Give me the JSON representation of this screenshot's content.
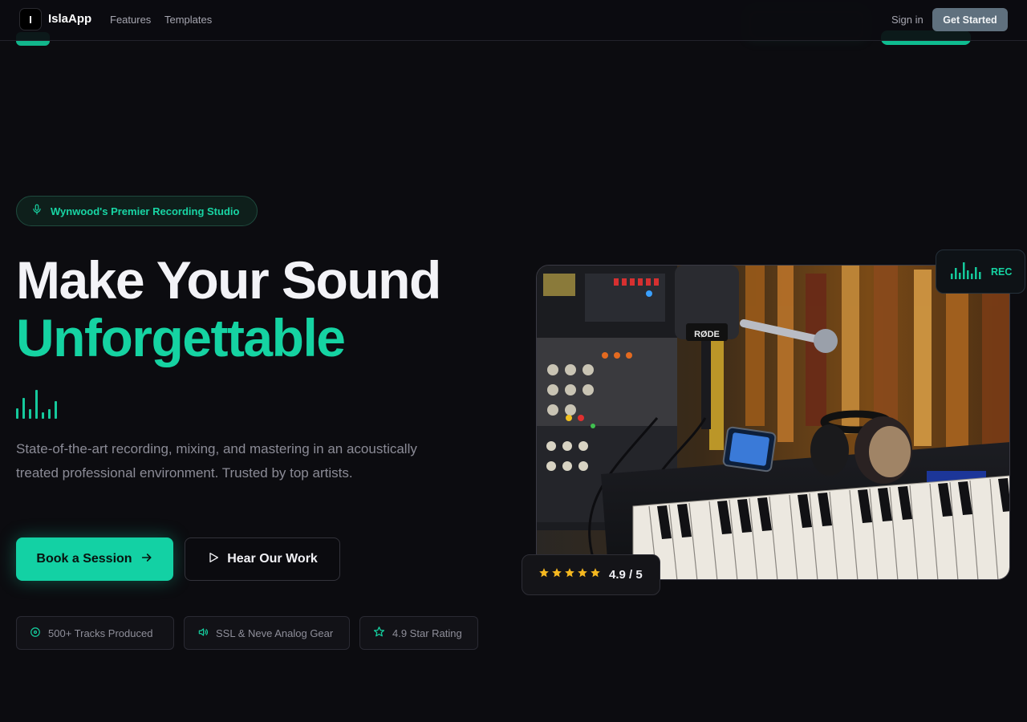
{
  "nav": {
    "logo_letter": "I",
    "brand": "IslaApp",
    "links": [
      "Features",
      "Templates"
    ],
    "signin": "Sign in",
    "cta": "Get Started"
  },
  "hero": {
    "badge": "Wynwood's Premier Recording Studio",
    "title_line1": "Make Your Sound",
    "title_line2": "Unforgettable",
    "description": "State-of-the-art recording, mixing, and mastering in an acoustically treated professional environment. Trusted by top artists.",
    "primary_button": "Book a Session",
    "secondary_button": "Hear Our Work",
    "stats": [
      "500+ Tracks Produced",
      "SSL & Neve Analog Gear",
      "4.9 Star Rating"
    ]
  },
  "media": {
    "rec_label": "REC",
    "mic_brand": "RØDE",
    "rating_stars": 5,
    "rating_text": "4.9 / 5"
  },
  "colors": {
    "accent": "#15d3a2",
    "background": "#0c0c10",
    "cta_nav": "#5f707e",
    "star": "#f5b820"
  }
}
